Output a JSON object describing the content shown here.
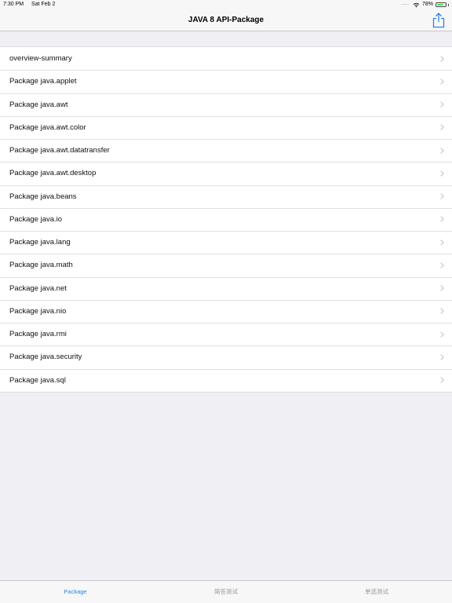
{
  "status_bar": {
    "time": "7:30 PM",
    "date": "Sat Feb 2",
    "signal": "·····",
    "battery_percent": "78%",
    "battery_level": 0.78
  },
  "nav": {
    "title": "JAVA 8 API-Package",
    "share_icon": "share-icon"
  },
  "list": {
    "items": [
      {
        "label": "overview-summary"
      },
      {
        "label": "Package java.applet"
      },
      {
        "label": "Package java.awt"
      },
      {
        "label": "Package java.awt.color"
      },
      {
        "label": "Package java.awt.datatransfer"
      },
      {
        "label": "Package java.awt.desktop"
      },
      {
        "label": "Package java.beans"
      },
      {
        "label": "Package java.io"
      },
      {
        "label": "Package java.lang"
      },
      {
        "label": "Package java.math"
      },
      {
        "label": "Package java.net"
      },
      {
        "label": "Package java.nio"
      },
      {
        "label": "Package java.rmi"
      },
      {
        "label": "Package java.security"
      },
      {
        "label": "Package java.sql"
      }
    ]
  },
  "tab_bar": {
    "tabs": [
      {
        "label": "Package",
        "active": true
      },
      {
        "label": "简答测试",
        "active": false
      },
      {
        "label": "单选测试",
        "active": false
      }
    ]
  },
  "colors": {
    "accent": "#2a85e8",
    "background": "#efeff4",
    "battery": "#4cd964"
  }
}
